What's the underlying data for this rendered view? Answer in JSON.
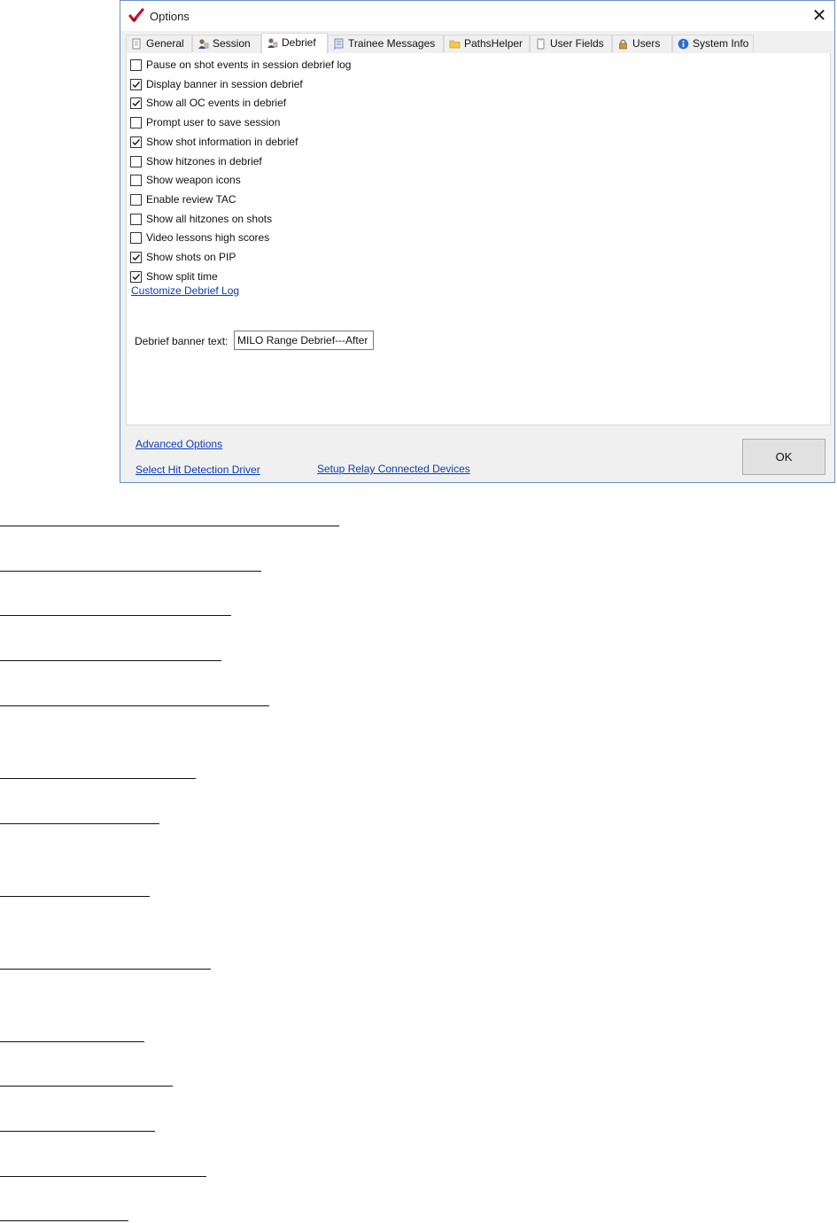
{
  "window": {
    "title": "Options",
    "app_icon": "red-checkmark-icon",
    "close_glyph": "✕"
  },
  "tabs": [
    {
      "label": "General",
      "icon": "page-icon",
      "active": false
    },
    {
      "label": "Session",
      "icon": "user-icon",
      "active": false
    },
    {
      "label": "Debrief",
      "icon": "user-icon",
      "active": true
    },
    {
      "label": "Trainee Messages",
      "icon": "message-icon",
      "active": false
    },
    {
      "label": "PathsHelper",
      "icon": "folder-icon",
      "active": false
    },
    {
      "label": "User Fields",
      "icon": "clipboard-icon",
      "active": false
    },
    {
      "label": "Users",
      "icon": "lock-icon",
      "active": false
    },
    {
      "label": "System Info",
      "icon": "info-icon",
      "active": false
    }
  ],
  "debrief": {
    "options": [
      {
        "label": "Pause on shot events in session debrief log",
        "checked": false
      },
      {
        "label": "Display banner in session debrief",
        "checked": true
      },
      {
        "label": "Show all OC events in debrief",
        "checked": true
      },
      {
        "label": "Prompt user to save session",
        "checked": false
      },
      {
        "label": "Show shot information in debrief",
        "checked": true
      },
      {
        "label": "Show hitzones in debrief",
        "checked": false
      },
      {
        "label": "Show weapon icons",
        "checked": false
      },
      {
        "label": "Enable review TAC",
        "checked": false
      },
      {
        "label": "Show all hitzones on shots",
        "checked": false
      },
      {
        "label": "Video lessons high scores",
        "checked": false
      },
      {
        "label": "Show shots on PIP",
        "checked": true
      },
      {
        "label": "Show split time",
        "checked": true
      }
    ],
    "customize_link": "Customize Debrief Log",
    "banner_label": "Debrief banner text:",
    "banner_value": "MILO Range Debrief---After Action Review"
  },
  "footer": {
    "advanced_options": "Advanced Options",
    "select_hit_detection": "Select Hit Detection Driver",
    "setup_relay": "Setup Relay Connected Devices",
    "ok": "OK"
  },
  "colors": {
    "link": "#0b3db8",
    "window_border": "#6a8fc8",
    "dialog_bg": "#f0f0f0"
  }
}
